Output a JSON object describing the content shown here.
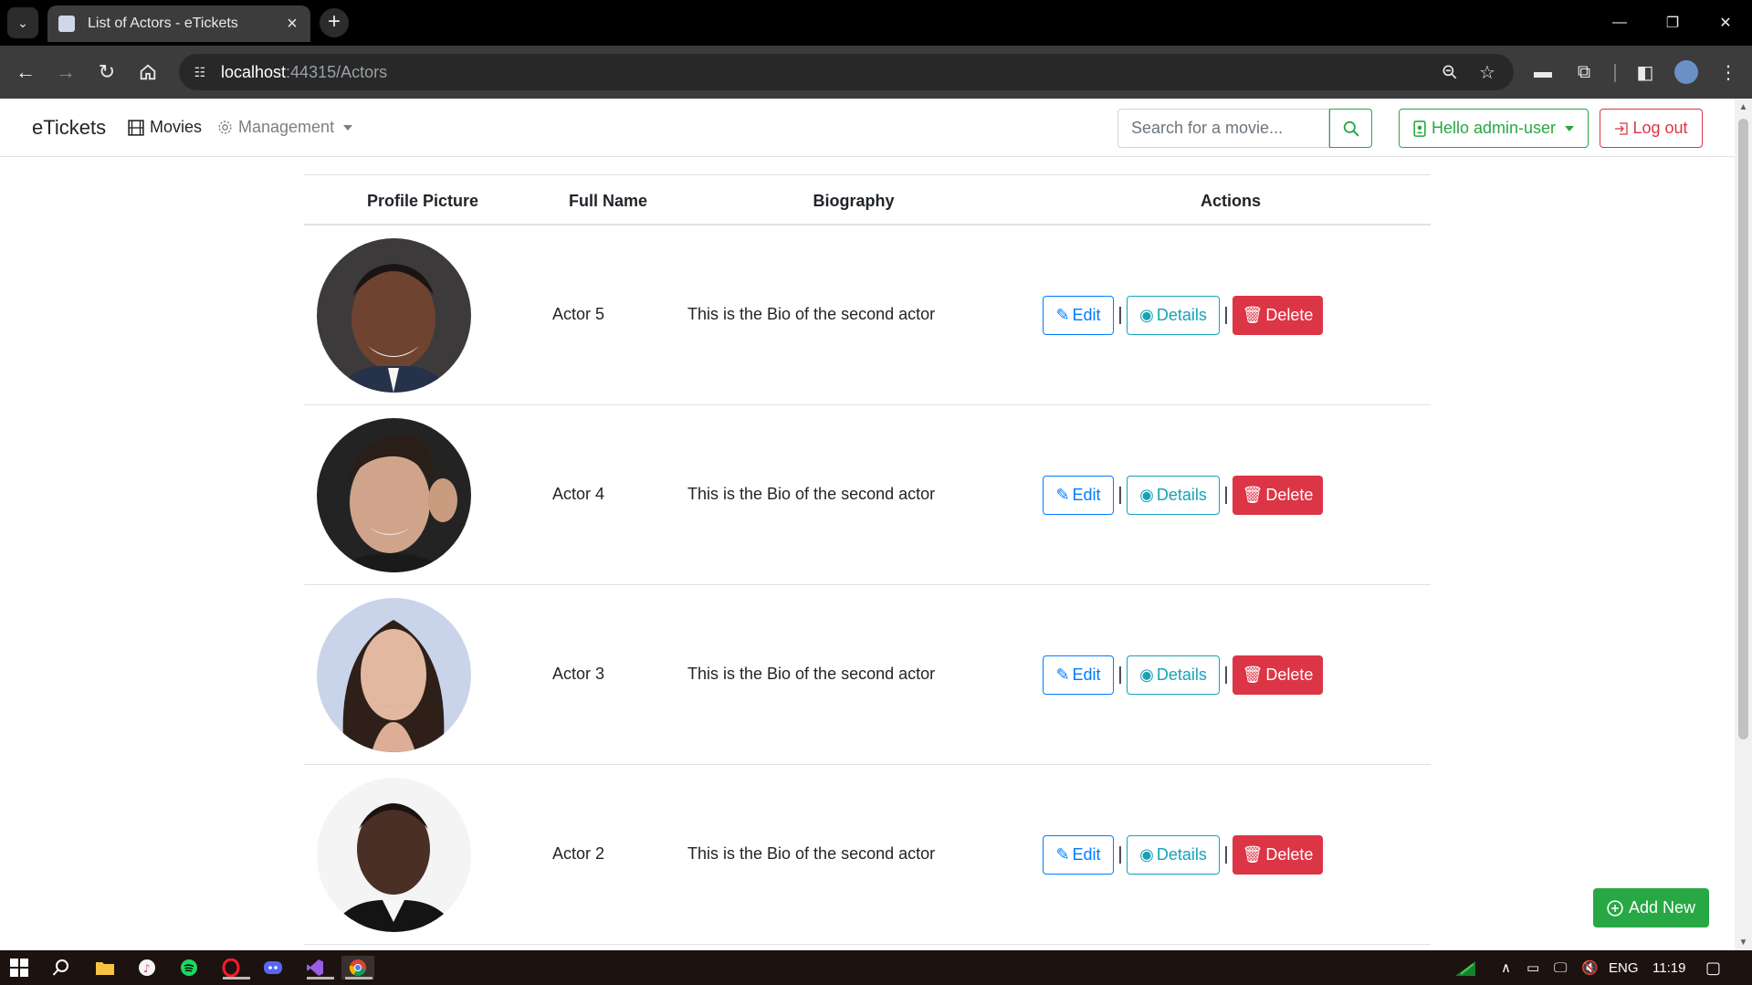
{
  "browser": {
    "tab_title": "List of Actors - eTickets",
    "url_host": "localhost",
    "url_path": ":44315/Actors"
  },
  "navbar": {
    "brand": "eTickets",
    "movies_label": "Movies",
    "management_label": "Management",
    "search_placeholder": "Search for a movie...",
    "user_label": "Hello admin-user",
    "logout_label": "Log out"
  },
  "table": {
    "headers": {
      "profile": "Profile Picture",
      "name": "Full Name",
      "bio": "Biography",
      "actions": "Actions"
    },
    "rows": [
      {
        "name": "Actor 5",
        "bio": "This is the Bio of the second actor"
      },
      {
        "name": "Actor 4",
        "bio": "This is the Bio of the second actor"
      },
      {
        "name": "Actor 3",
        "bio": "This is the Bio of the second actor"
      },
      {
        "name": "Actor 2",
        "bio": "This is the Bio of the second actor"
      }
    ],
    "action_labels": {
      "edit": "Edit",
      "details": "Details",
      "delete": "Delete",
      "separator": "|"
    }
  },
  "add_new_label": "Add New",
  "taskbar": {
    "language": "ENG",
    "time": "11:19"
  },
  "colors": {
    "success": "#28a745",
    "danger": "#dc3545",
    "primary": "#007bff",
    "info": "#17a2b8"
  }
}
